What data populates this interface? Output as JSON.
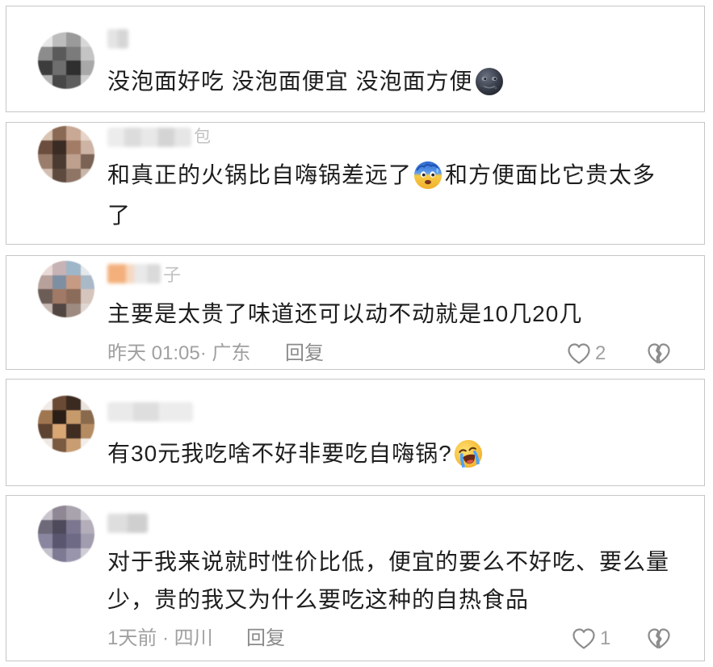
{
  "colors": {
    "text_primary": "#1e1e1e",
    "text_meta": "#a0a0a0",
    "reply": "#8a8a8a",
    "icon": "#8c8c8c",
    "card_border": "#c6c6c6"
  },
  "icons": {
    "like": "heart-outline-icon",
    "dislike": "broken-heart-icon"
  },
  "comments": [
    {
      "lines": [
        [
          {
            "text": "没泡面好吃 没泡面便宜 没泡面方便"
          },
          {
            "emoji": "new-moon-face"
          }
        ]
      ]
    },
    {
      "username_visible_part": "包",
      "lines": [
        [
          {
            "text": "和真正的火锅比自嗨锅差远了"
          },
          {
            "emoji": "anxious-face-with-sweat"
          },
          {
            "text": "和方便面比它贵太多"
          }
        ],
        [
          {
            "text": "了"
          }
        ]
      ]
    },
    {
      "username_visible_part": "子",
      "lines": [
        [
          {
            "text": "主要是太贵了味道还可以动不动就是10几20几"
          }
        ]
      ],
      "footer": {
        "meta": "昨天 01:05· 广东",
        "reply": "回复",
        "likes": "2"
      }
    },
    {
      "lines": [
        [
          {
            "text": "有30元我吃啥不好非要吃自嗨锅?"
          },
          {
            "emoji": "loudly-crying-face"
          }
        ]
      ]
    },
    {
      "lines": [
        [
          {
            "text": "对于我来说就时性价比低，便宜的要么不好吃、要么量"
          }
        ],
        [
          {
            "text": "少，贵的我又为什么要吃这种的自热食品"
          }
        ]
      ],
      "footer": {
        "meta": "1天前 · 四川",
        "reply": "回复",
        "likes": "1"
      }
    }
  ]
}
